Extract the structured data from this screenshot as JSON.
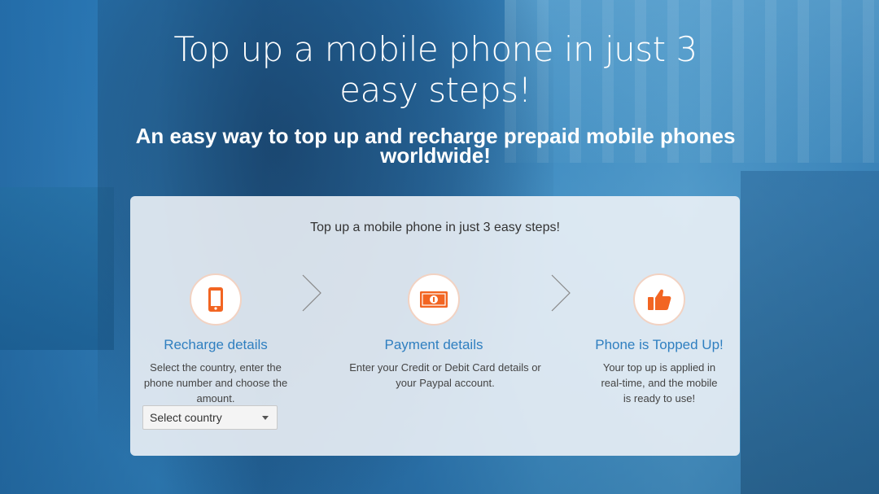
{
  "hero": {
    "title": "Top up a mobile phone in just 3 easy steps!",
    "subtitle": "An easy way to top up and recharge prepaid mobile phones worldwide!"
  },
  "card": {
    "heading": "Top up a mobile phone in just 3 easy steps!",
    "steps": [
      {
        "icon": "mobile-phone-icon",
        "title": "Recharge details",
        "description": "Select the country, enter the phone number and choose the amount."
      },
      {
        "icon": "banknote-icon",
        "title": "Payment details",
        "description": "Enter your Credit or Debit Card details or your Paypal account."
      },
      {
        "icon": "thumbs-up-icon",
        "title": "Phone is Topped Up!",
        "description": "Your top up is applied in real-time, and the mobile is ready to use!"
      }
    ],
    "country_select": {
      "selected": "Select country"
    }
  },
  "colors": {
    "accent_orange": "#f26522",
    "step_title_blue": "#2f7fc0",
    "overlay_blue": "#2a6aa0"
  }
}
